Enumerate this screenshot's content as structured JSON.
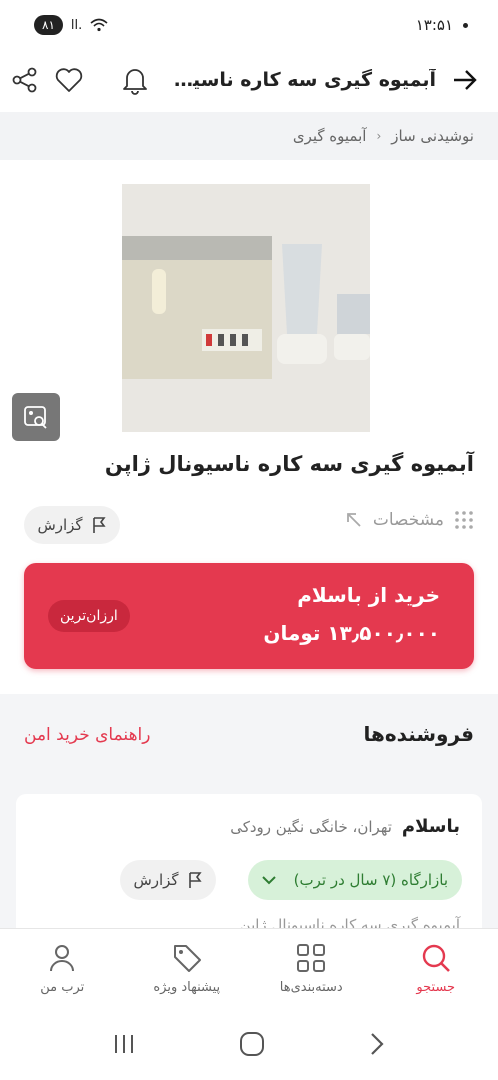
{
  "status_bar": {
    "time": "۱۳:۵۱",
    "battery": "۸۱",
    "signal_label": "ll."
  },
  "app_bar": {
    "title": "آبمیوه گیری سه کاره ناسیونا...",
    "icons": [
      "arrow-right-icon",
      "bell-icon",
      "heart-icon",
      "share-icon"
    ]
  },
  "breadcrumb": {
    "items": [
      "نوشیدنی ساز",
      "آبمیوه گیری"
    ],
    "separator": "‹"
  },
  "product": {
    "title": "آبمیوه گیری سه کاره ناسیونال ژاپن",
    "specs_label": "مشخصات",
    "report_label": "گزارش"
  },
  "buy_card": {
    "title": "خرید از باسلام",
    "price": "۱۳٫۵۰۰٫۰۰۰ تومان",
    "badge": "ارزان‌ترین",
    "color": "#e4394f"
  },
  "sellers": {
    "header": "فروشنده‌ها",
    "safe_guide": "راهنمای خرید امن",
    "seller_name": "باسلام",
    "seller_location": "تهران، خانگی نگین رودکی",
    "market_badge": "بازارگاه (۷ سال در ترب)",
    "report_label": "گزارش",
    "description": "آبمیوه گیری سه کاره ناسیونال ژاپن"
  },
  "bottom_nav": {
    "items": [
      {
        "label": "جستجو",
        "icon": "search-icon",
        "active": true
      },
      {
        "label": "دسته‌بندی‌ها",
        "icon": "grid-icon",
        "active": false
      },
      {
        "label": "پیشنهاد ویژه",
        "icon": "tag-icon",
        "active": false
      },
      {
        "label": "ترب من",
        "icon": "user-icon",
        "active": false
      }
    ]
  }
}
